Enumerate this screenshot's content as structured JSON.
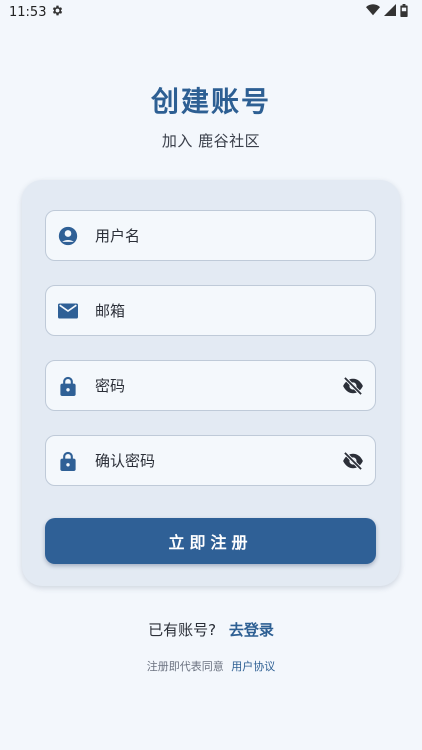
{
  "status_bar": {
    "time": "11:53"
  },
  "header": {
    "title": "创建账号",
    "subtitle": "加入 鹿谷社区"
  },
  "form": {
    "username_placeholder": "用户名",
    "email_placeholder": "邮箱",
    "password_placeholder": "密码",
    "confirm_password_placeholder": "确认密码",
    "submit_label": "立即注册"
  },
  "footer": {
    "has_account_text": "已有账号?",
    "login_link": "去登录",
    "terms_prefix": "注册即代表同意",
    "terms_link": "用户协议"
  },
  "colors": {
    "primary": "#2f6096",
    "background": "#f3f7fc",
    "card": "#e3eaf3"
  },
  "icons": {
    "status": [
      "gear-icon",
      "wifi-icon",
      "signal-icon",
      "battery-icon"
    ],
    "fields": [
      "account-circle-icon",
      "mail-icon",
      "lock-icon",
      "lock-icon"
    ],
    "toggles": [
      "visibility-off-icon",
      "visibility-off-icon"
    ]
  }
}
